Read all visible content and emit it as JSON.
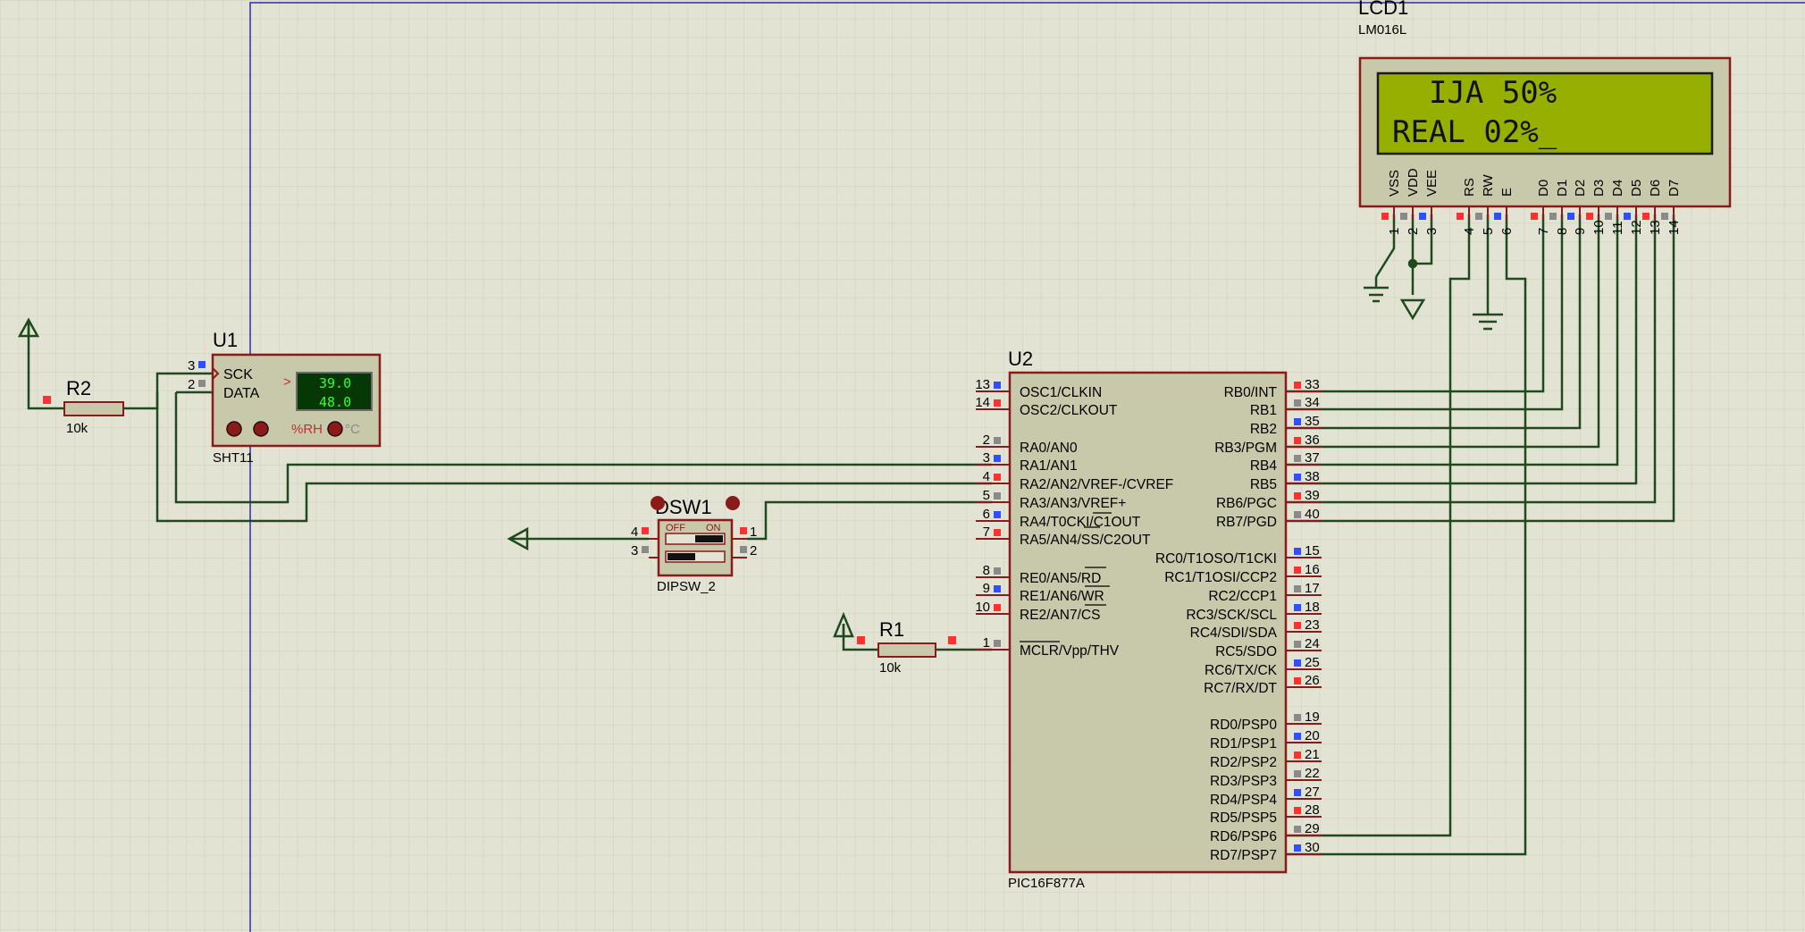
{
  "lcd": {
    "ref": "LCD1",
    "part": "LM016L",
    "line1": "  IJA 50%",
    "line2": "REAL 02%_",
    "pin_names": [
      "VSS",
      "VDD",
      "VEE",
      "RS",
      "RW",
      "E",
      "D0",
      "D1",
      "D2",
      "D3",
      "D4",
      "D5",
      "D6",
      "D7"
    ],
    "pin_numbers": [
      "1",
      "2",
      "3",
      "4",
      "5",
      "6",
      "7",
      "8",
      "9",
      "10",
      "11",
      "12",
      "13",
      "14"
    ]
  },
  "u1": {
    "ref": "U1",
    "part": "SHT11",
    "pin_sck": "SCK",
    "pin_data": "DATA",
    "pin_num_sck": "3",
    "pin_num_data": "2",
    "arrow": ">",
    "display_top": "39.0",
    "display_bottom": "48.0",
    "unit_rh": "%RH",
    "unit_c": "°C"
  },
  "r2": {
    "ref": "R2",
    "value": "10k"
  },
  "r1": {
    "ref": "R1",
    "value": "10k"
  },
  "dsw1": {
    "ref": "DSW1",
    "part": "DIPSW_2",
    "off_label": "OFF",
    "on_label": "ON",
    "left_pins": [
      "4",
      "3"
    ],
    "right_pins": [
      "1",
      "2"
    ]
  },
  "u2": {
    "ref": "U2",
    "part": "PIC16F877A",
    "left_pins": [
      {
        "num": "13",
        "name": "OSC1/CLKIN"
      },
      {
        "num": "14",
        "name": "OSC2/CLKOUT"
      },
      {
        "num": "2",
        "name": "RA0/AN0"
      },
      {
        "num": "3",
        "name": "RA1/AN1"
      },
      {
        "num": "4",
        "name": "RA2/AN2/VREF-/CVREF"
      },
      {
        "num": "5",
        "name": "RA3/AN3/VREF+"
      },
      {
        "num": "6",
        "name": "RA4/T0CKI/C1OUT"
      },
      {
        "num": "7",
        "name": "RA5/AN4/SS/C2OUT"
      },
      {
        "num": "8",
        "name": "RE0/AN5/RD"
      },
      {
        "num": "9",
        "name": "RE1/AN6/WR"
      },
      {
        "num": "10",
        "name": "RE2/AN7/CS"
      },
      {
        "num": "1",
        "name": "MCLR/Vpp/THV"
      }
    ],
    "right_pins": [
      {
        "num": "33",
        "name": "RB0/INT"
      },
      {
        "num": "34",
        "name": "RB1"
      },
      {
        "num": "35",
        "name": "RB2"
      },
      {
        "num": "36",
        "name": "RB3/PGM"
      },
      {
        "num": "37",
        "name": "RB4"
      },
      {
        "num": "38",
        "name": "RB5"
      },
      {
        "num": "39",
        "name": "RB6/PGC"
      },
      {
        "num": "40",
        "name": "RB7/PGD"
      },
      {
        "num": "15",
        "name": "RC0/T1OSO/T1CKI"
      },
      {
        "num": "16",
        "name": "RC1/T1OSI/CCP2"
      },
      {
        "num": "17",
        "name": "RC2/CCP1"
      },
      {
        "num": "18",
        "name": "RC3/SCK/SCL"
      },
      {
        "num": "23",
        "name": "RC4/SDI/SDA"
      },
      {
        "num": "24",
        "name": "RC5/SDO"
      },
      {
        "num": "25",
        "name": "RC6/TX/CK"
      },
      {
        "num": "26",
        "name": "RC7/RX/DT"
      },
      {
        "num": "19",
        "name": "RD0/PSP0"
      },
      {
        "num": "20",
        "name": "RD1/PSP1"
      },
      {
        "num": "21",
        "name": "RD2/PSP2"
      },
      {
        "num": "22",
        "name": "RD3/PSP3"
      },
      {
        "num": "27",
        "name": "RD4/PSP4"
      },
      {
        "num": "28",
        "name": "RD5/PSP5"
      },
      {
        "num": "29",
        "name": "RD6/PSP6"
      },
      {
        "num": "30",
        "name": "RD7/PSP7"
      }
    ]
  },
  "colors": {
    "background": "#e3e3d3",
    "grid": "#cfcfbf",
    "component_body": "#c8c8aa",
    "component_border": "#8b1a1a",
    "wire": "#1e4a1e",
    "lcd_screen": "#97b000",
    "pin_red": "#ff3030",
    "pin_blue": "#2f4fff",
    "pin_gray": "#8a8a8a",
    "sheet_border": "#2a2ab0"
  }
}
